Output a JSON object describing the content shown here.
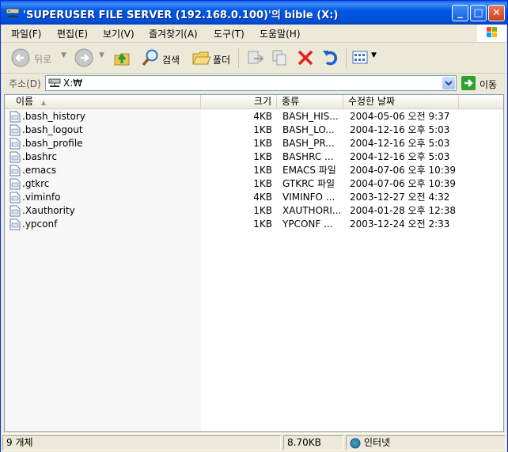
{
  "window": {
    "title": "'SUPERUSER FILE SERVER (192.168.0.100)'의 bible (X:)",
    "minimize_glyph": "_",
    "maximize_glyph": "□",
    "close_glyph": "✕"
  },
  "menu": {
    "items": [
      "파일(F)",
      "편집(E)",
      "보기(V)",
      "즐겨찾기(A)",
      "도구(T)",
      "도움말(H)"
    ]
  },
  "toolbar": {
    "back_label": "뒤로",
    "search_label": "검색",
    "folders_label": "폴더"
  },
  "address": {
    "label": "주소(D)",
    "value": "X:₩",
    "go_label": "이동"
  },
  "columns": [
    "이름",
    "크기",
    "종류",
    "수정한 날짜"
  ],
  "files": [
    {
      "name": ".bash_history",
      "size": "4KB",
      "type": "BASH_HIS...",
      "modified": "2004-05-06 오전 9:37"
    },
    {
      "name": ".bash_logout",
      "size": "1KB",
      "type": "BASH_LO...",
      "modified": "2004-12-16 오후 5:03"
    },
    {
      "name": ".bash_profile",
      "size": "1KB",
      "type": "BASH_PR...",
      "modified": "2004-12-16 오후 5:03"
    },
    {
      "name": ".bashrc",
      "size": "1KB",
      "type": "BASHRC ...",
      "modified": "2004-12-16 오후 5:03"
    },
    {
      "name": ".emacs",
      "size": "1KB",
      "type": "EMACS 파일",
      "modified": "2004-07-06 오후 10:39"
    },
    {
      "name": ".gtkrc",
      "size": "1KB",
      "type": "GTKRC 파일",
      "modified": "2004-07-06 오후 10:39"
    },
    {
      "name": ".viminfo",
      "size": "4KB",
      "type": "VIMINFO ...",
      "modified": "2003-12-27 오전 4:32"
    },
    {
      "name": ".Xauthority",
      "size": "1KB",
      "type": "XAUTHORI...",
      "modified": "2004-01-28 오후 12:38"
    },
    {
      "name": ".ypconf",
      "size": "1KB",
      "type": "YPCONF ...",
      "modified": "2003-12-24 오전 2:33"
    }
  ],
  "status": {
    "count": "9 개체",
    "size": "8.70KB",
    "zone": "인터넷"
  },
  "icons": {
    "title": "network-drive-icon",
    "back": "back-arrow-icon",
    "forward": "forward-arrow-icon",
    "up": "folder-up-icon",
    "search": "magnifier-icon",
    "folders": "folder-icon",
    "move": "move-to-icon",
    "copy": "copy-to-icon",
    "delete": "delete-x-icon",
    "undo": "undo-icon",
    "views": "views-icon"
  },
  "colors": {
    "titlebar": "#0058e6",
    "delete": "#e02020",
    "undo": "#1f5ec9",
    "go": "#2ea12e"
  }
}
